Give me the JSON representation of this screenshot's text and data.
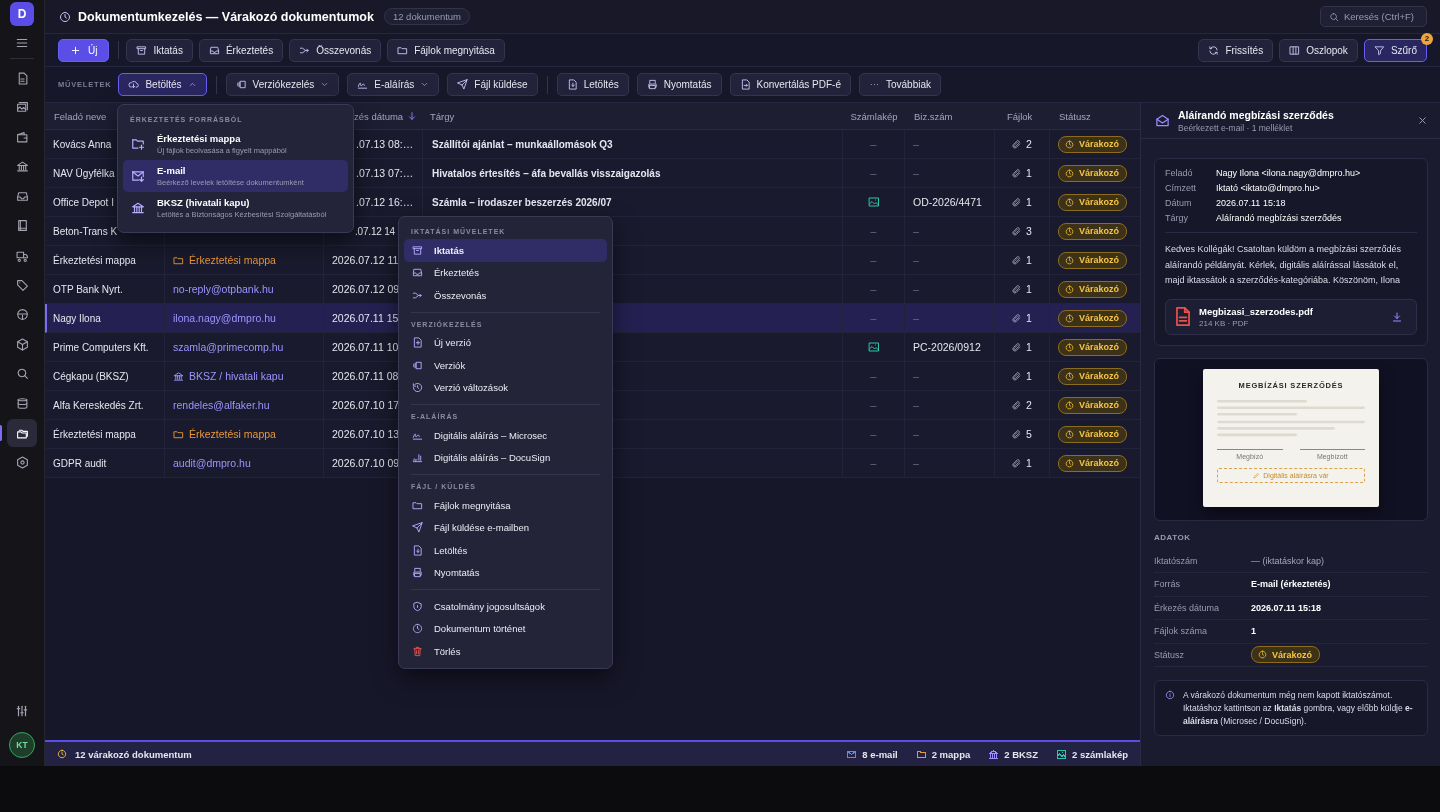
{
  "sidebar": {
    "logo": "D",
    "items": [
      {
        "selected": false
      },
      {
        "selected": false
      },
      {
        "selected": false
      },
      {
        "selected": false
      },
      {
        "selected": false
      },
      {
        "selected": false
      },
      {
        "selected": false
      },
      {
        "selected": false
      },
      {
        "selected": false
      },
      {
        "selected": false
      },
      {
        "selected": false
      },
      {
        "selected": false
      },
      {
        "selected": true
      },
      {
        "selected": false
      }
    ],
    "avatar": "KT"
  },
  "header": {
    "title": "Dokumentumkezelés — Várakozó dokumentumok",
    "count": "12 dokumentum",
    "search": {
      "placeholder": "Keresés (Ctrl+F)"
    }
  },
  "toolbar": {
    "primary": "Új",
    "buttons": [
      "Iktatás",
      "Érkeztetés",
      "Összevonás",
      "Fájlok megnyitása"
    ],
    "right_buttons": [
      {
        "label": "Frissítés",
        "selected": false
      },
      {
        "label": "Oszlopok",
        "selected": false
      },
      {
        "label": "Szűrő",
        "selected": true,
        "badge": "2"
      }
    ]
  },
  "actions": {
    "label": "MŰVELETEK",
    "groups": [
      {
        "buttons": [
          {
            "label": "Betöltés",
            "kind": "dropdown",
            "expanded": true
          }
        ]
      },
      {
        "buttons": [
          {
            "label": "Verziókezelés",
            "kind": "dropdown",
            "expanded": false
          },
          {
            "label": "E-aláírás",
            "kind": "dropdown",
            "expanded": false
          },
          {
            "label": "Fájl küldése",
            "kind": "button"
          }
        ]
      },
      {
        "buttons": [
          {
            "label": "Letöltés",
            "kind": "button"
          },
          {
            "label": "Nyomtatás",
            "kind": "button"
          },
          {
            "label": "Konvertálás PDF-é",
            "kind": "button"
          },
          {
            "label": "Továbbiak",
            "kind": "button"
          }
        ]
      }
    ]
  },
  "load_menu": {
    "heading": "ÉRKEZTETÉS FORRÁSBÓL",
    "items": [
      {
        "title": "Érkeztetési mappa",
        "description": "Új fájlok beolvasása a figyelt mappából",
        "selected": false
      },
      {
        "title": "E-mail",
        "description": "Beérkező levelek letöltése dokumentumként",
        "selected": true
      },
      {
        "title": "BKSZ (hivatali kapu)",
        "description": "Letöltés a Biztonságos Kézbesítési Szolgáltatásból",
        "selected": false
      }
    ]
  },
  "table": {
    "columns": [
      {
        "label": "Feladó neve",
        "kind": "name"
      },
      {
        "label": "zés dátuma",
        "kind": "date",
        "sorted": true
      },
      {
        "label": "Tárgy",
        "kind": "subject"
      },
      {
        "label": "Számlakép",
        "kind": "invoice"
      },
      {
        "label": "Biz.szám",
        "kind": "docno"
      },
      {
        "label": "Fájlok",
        "kind": "files"
      },
      {
        "label": "Státusz",
        "kind": "status"
      }
    ],
    "rows": [
      {
        "name": "Kovács Anna",
        "date": ".07.13 08:…",
        "subject": "Szállítói ajánlat – munkaállomások Q3",
        "invoice_image": false,
        "invoice": "–",
        "doc_no": "–",
        "files": "2",
        "status": "Várakozó",
        "selected": false
      },
      {
        "name": "NAV Ügyfélka",
        "date": ".07.13 07:…",
        "subject": "Hivatalos értesítés – áfa bevallás visszaigazolás",
        "invoice_image": false,
        "invoice": "–",
        "doc_no": "–",
        "files": "1",
        "status": "Várakozó",
        "selected": false
      },
      {
        "name": "Office Depot I",
        "date": ".07.12 16:…",
        "subject": "Számla – irodaszer beszerzés 2026/07",
        "invoice_image": true,
        "doc_no": "OD-2026/4471",
        "files": "1",
        "status": "Várakozó",
        "selected": false
      },
      {
        "name": "Beton-Trans K",
        "date": ".07.12 14",
        "invoice_image": false,
        "invoice": "–",
        "doc_no": "–",
        "files": "3",
        "status": "Várakozó",
        "selected": false
      },
      {
        "name": "Érkeztetési mappa",
        "sender": {
          "kind": "folder",
          "text": "Érkeztetési mappa"
        },
        "date": "2026.07.12 11",
        "invoice_image": false,
        "invoice": "–",
        "doc_no": "–",
        "files": "1",
        "status": "Várakozó",
        "selected": false
      },
      {
        "name": "OTP Bank Nyrt.",
        "sender": {
          "kind": "email",
          "text": "no-reply@otpbank.hu"
        },
        "date": "2026.07.12 09",
        "invoice_image": false,
        "invoice": "–",
        "doc_no": "–",
        "files": "1",
        "status": "Várakozó",
        "selected": false
      },
      {
        "name": "Nagy Ilona",
        "sender": {
          "kind": "email",
          "text": "ilona.nagy@dmpro.hu"
        },
        "date": "2026.07.11 15",
        "invoice_image": false,
        "invoice": "–",
        "doc_no": "–",
        "files": "1",
        "status": "Várakozó",
        "selected": true
      },
      {
        "name": "Prime Computers Kft.",
        "sender": {
          "kind": "email",
          "text": "szamla@primecomp.hu"
        },
        "date": "2026.07.11 10",
        "invoice_image": true,
        "doc_no": "PC-2026/0912",
        "files": "1",
        "status": "Várakozó",
        "selected": false
      },
      {
        "name": "Cégkapu (BKSZ)",
        "sender": {
          "kind": "bksz",
          "text": "BKSZ / hivatali kapu"
        },
        "date": "2026.07.11 08",
        "invoice_image": false,
        "invoice": "–",
        "doc_no": "–",
        "files": "1",
        "status": "Várakozó",
        "selected": false
      },
      {
        "name": "Alfa Kereskedés Zrt.",
        "sender": {
          "kind": "email",
          "text": "rendeles@alfaker.hu"
        },
        "date": "2026.07.10 17",
        "invoice_image": false,
        "invoice": "–",
        "doc_no": "–",
        "files": "2",
        "status": "Várakozó",
        "selected": false
      },
      {
        "name": "Érkeztetési mappa",
        "sender": {
          "kind": "folder",
          "text": "Érkeztetési mappa"
        },
        "date": "2026.07.10 13",
        "invoice_image": false,
        "invoice": "–",
        "doc_no": "–",
        "files": "5",
        "status": "Várakozó",
        "selected": false
      },
      {
        "name": "GDPR audit",
        "sender": {
          "kind": "email",
          "text": "audit@dmpro.hu"
        },
        "date": "2026.07.10 09",
        "invoice_image": false,
        "invoice": "–",
        "doc_no": "–",
        "files": "1",
        "status": "Várakozó",
        "selected": false
      }
    ]
  },
  "context_menu": {
    "sections": [
      {
        "heading": "IKTATÁSI MŰVELETEK",
        "items": [
          {
            "label": "Iktatás",
            "selected": true,
            "danger": false
          },
          {
            "label": "Érkeztetés",
            "selected": false,
            "danger": false
          },
          {
            "label": "Összevonás",
            "selected": false,
            "danger": false
          }
        ]
      },
      {
        "heading": "VERZIÓKEZELÉS",
        "items": [
          {
            "label": "Új verzió",
            "selected": false,
            "danger": false
          },
          {
            "label": "Verziók",
            "selected": false,
            "danger": false
          },
          {
            "label": "Verzió változások",
            "selected": false,
            "danger": false
          }
        ]
      },
      {
        "heading": "E-ALÁÍRÁS",
        "items": [
          {
            "label": "Digitális aláírás – Microsec",
            "selected": false,
            "danger": false
          },
          {
            "label": "Digitális aláírás – DocuSign",
            "selected": false,
            "danger": false
          }
        ]
      },
      {
        "heading": "FÁJL / KÜLDÉS",
        "items": [
          {
            "label": "Fájlok megnyitása",
            "selected": false,
            "danger": false
          },
          {
            "label": "Fájl küldése e-mailben",
            "selected": false,
            "danger": false
          },
          {
            "label": "Letöltés",
            "selected": false,
            "danger": false
          },
          {
            "label": "Nyomtatás",
            "selected": false,
            "danger": false
          }
        ]
      },
      {
        "items": [
          {
            "label": "Csatolmány jogosultságok",
            "selected": false,
            "danger": false
          },
          {
            "label": "Dokumentum történet",
            "selected": false,
            "danger": false
          },
          {
            "label": "Törlés",
            "selected": false,
            "danger": true
          }
        ]
      }
    ]
  },
  "status_bar": {
    "text": "12 várakozó dokumentum",
    "counters": [
      {
        "kind": "email",
        "text": "8 e-mail",
        "color": "#5b8def"
      },
      {
        "kind": "folder",
        "text": "2 mappa",
        "color": "#e8973a"
      },
      {
        "kind": "bksz",
        "text": "2 BKSZ",
        "color": "#9d8cff"
      },
      {
        "kind": "image",
        "text": "2 számlakép",
        "color": "#2ec4a6"
      }
    ]
  },
  "detail": {
    "title": "Aláírandó megbízási szerződés",
    "subtitle": "Beérkezett e-mail · 1 melléklet",
    "meta": [
      {
        "label": "Feladó",
        "value": "Nagy Ilona <ilona.nagy@dmpro.hu>"
      },
      {
        "label": "Címzett",
        "value": "Iktató <iktato@dmpro.hu>"
      },
      {
        "label": "Dátum",
        "value": "2026.07.11 15:18"
      },
      {
        "label": "Tárgy",
        "value": "Aláírandó megbízási szerződés"
      }
    ],
    "body": "Kedves Kollégák! Csatoltan küldöm a megbízási szerződés aláírandó példányát. Kérlek, digitális aláírással lássátok el, majd iktassátok a szerződés-kategóriába. Köszönöm, Ilona",
    "attachment": {
      "name": "Megbizasi_szerzodes.pdf",
      "info": "214 KB · PDF"
    },
    "preview": {
      "title": "MEGBÍZÁSI SZERZŐDÉS",
      "signers": [
        "Megbízó",
        "Megbízott"
      ],
      "stamp": "Digitális aláírásra vár"
    },
    "data_heading": "ADATOK",
    "fields": [
      {
        "label": "Iktatószám",
        "value": "— (iktatáskor kap)",
        "kind": "muted"
      },
      {
        "label": "Forrás",
        "value": "E-mail (érkeztetés)",
        "kind": "text"
      },
      {
        "label": "Érkezés dátuma",
        "value": "2026.07.11 15:18",
        "kind": "text"
      },
      {
        "label": "Fájlok száma",
        "value": "1",
        "kind": "text"
      },
      {
        "label": "Státusz",
        "value": "Várakozó",
        "kind": "status"
      }
    ],
    "note": "A várakozó dokumentum még nem kapott iktatószámot. Iktatáshoz kattintson az **Iktatás** gombra, vagy előbb küldje **e-aláírásra** (Microsec / DocuSign)."
  }
}
